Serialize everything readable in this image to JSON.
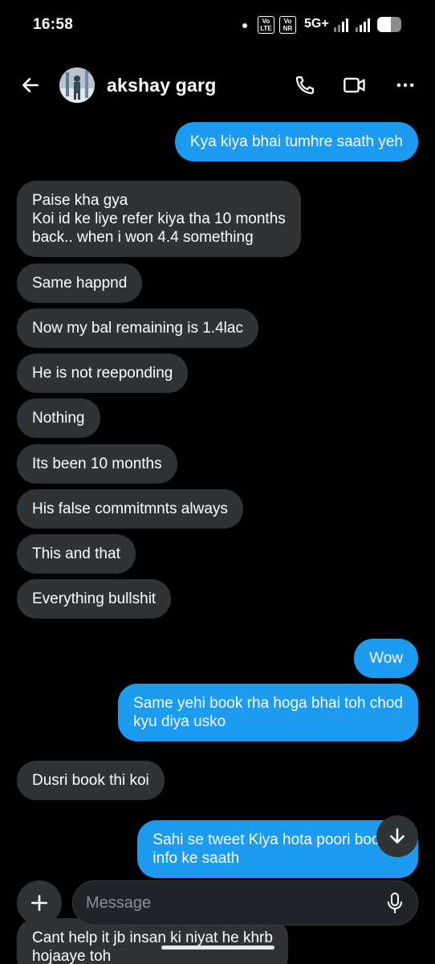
{
  "status_bar": {
    "time": "16:58",
    "sim1": [
      "Vo",
      "LTE",
      "2"
    ],
    "sim2": [
      "Vo",
      "NR",
      "1"
    ],
    "network": "5G+",
    "battery_level": 0.55
  },
  "header": {
    "contact_name": "akshay garg",
    "back_icon": "arrow-left-icon",
    "call_icon": "phone-icon",
    "video_icon": "video-camera-icon",
    "more_icon": "more-horizontal-icon"
  },
  "messages": [
    {
      "direction": "out",
      "lines": [
        "Kya kiya bhai tumhre saath yeh"
      ]
    },
    {
      "direction": "in",
      "lines": [
        "Paise kha gya",
        "Koi id ke liye refer kiya tha 10 months",
        "back.. when i won 4.4 something"
      ]
    },
    {
      "direction": "in",
      "lines": [
        "Same happnd"
      ]
    },
    {
      "direction": "in",
      "lines": [
        "Now my bal remaining is 1.4lac"
      ]
    },
    {
      "direction": "in",
      "lines": [
        "He is not reeponding"
      ]
    },
    {
      "direction": "in",
      "lines": [
        "Nothing"
      ]
    },
    {
      "direction": "in",
      "lines": [
        "Its been 10 months"
      ]
    },
    {
      "direction": "in",
      "lines": [
        "His false commitmnts always"
      ]
    },
    {
      "direction": "in",
      "lines": [
        "This and that"
      ]
    },
    {
      "direction": "in",
      "lines": [
        "Everything bullshit"
      ]
    },
    {
      "direction": "out",
      "lines": [
        "Wow"
      ]
    },
    {
      "direction": "out",
      "lines": [
        "Same yehi book rha hoga bhai toh chod",
        "kyu diya usko"
      ]
    },
    {
      "direction": "in",
      "lines": [
        "Dusri book thi koi"
      ]
    },
    {
      "direction": "out",
      "lines": [
        "Sahi se tweet Kiya hota poori book ki",
        "info ke saath"
      ]
    },
    {
      "direction": "in",
      "lines": [
        "Cant help it jb insan ki niyat he khrb",
        "hojaaye toh"
      ]
    }
  ],
  "composer": {
    "placeholder": "Message",
    "add_icon": "plus-icon",
    "mic_icon": "microphone-icon"
  },
  "scroll_fab_icon": "arrow-down-icon",
  "colors": {
    "background": "#000000",
    "incoming_bubble": "#2f3336",
    "outgoing_bubble": "#1d9bf0",
    "text": "#ffffff",
    "placeholder": "#8b9096"
  }
}
